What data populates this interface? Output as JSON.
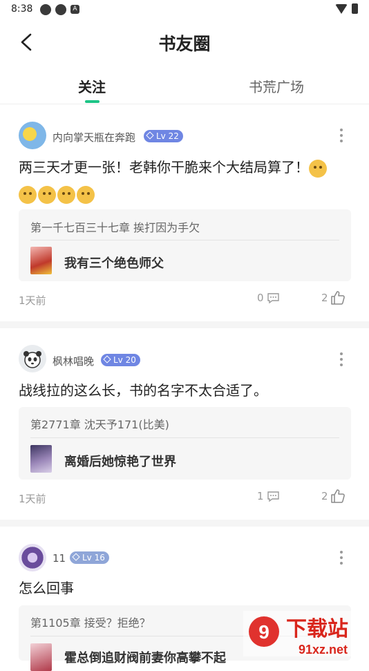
{
  "status": {
    "time": "8:38"
  },
  "header": {
    "title": "书友圈"
  },
  "tabs": [
    {
      "label": "关注"
    },
    {
      "label": "书荒广场"
    }
  ],
  "colors": {
    "accent": "#1dc486",
    "lv_badge": "#6f86e3",
    "lv_badge_low": "#8fa6d8"
  },
  "posts": [
    {
      "username": "内向掌天瓶在奔跑",
      "level": "Lv 22",
      "content": "两三天才更一张！老韩你干脆来个大结局算了！",
      "emoji_count": 5,
      "chapter": "第一千七百三十七章 挨打因为手欠",
      "book": "我有三个绝色师父",
      "time": "1天前",
      "comments": "0",
      "likes": "2"
    },
    {
      "username": "枫林唱晚",
      "level": "Lv 20",
      "content": "战线拉的这么长，书的名字不太合适了。",
      "chapter": "第2771章 沈天予171(比美)",
      "book": "离婚后她惊艳了世界",
      "time": "1天前",
      "comments": "1",
      "likes": "2"
    },
    {
      "username": "11",
      "level": "Lv 16",
      "content": "怎么回事",
      "chapter": "第1105章 接受？拒绝？",
      "book": "霍总倒追财阀前妻你高攀不起"
    }
  ],
  "watermark": {
    "text": "下载站",
    "url": "91xz.net"
  }
}
